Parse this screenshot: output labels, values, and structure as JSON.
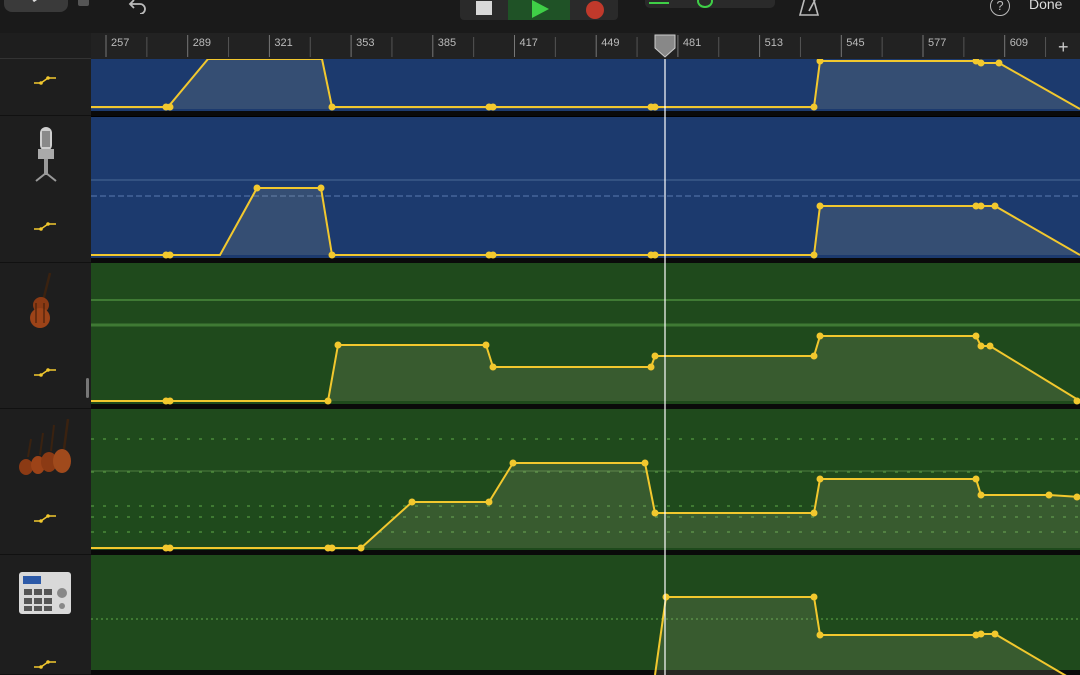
{
  "toolbar": {
    "done_label": "Done",
    "help_label": "?",
    "plus_label": "+"
  },
  "ruler": {
    "bars": [
      "257",
      "289",
      "321",
      "353",
      "385",
      "417",
      "449",
      "481",
      "513",
      "545",
      "577",
      "609"
    ]
  },
  "tracks": [
    {
      "name": "track-1",
      "icon": "automation-icon",
      "color": "#1c3a6e"
    },
    {
      "name": "track-2-vocal",
      "icon": "microphone-icon",
      "color": "#1c3a6e"
    },
    {
      "name": "track-3-cello",
      "icon": "cello-icon",
      "color": "#1f4a1c"
    },
    {
      "name": "track-4-strings",
      "icon": "string-section-icon",
      "color": "#1f4a1c"
    },
    {
      "name": "track-5-drum-machine",
      "icon": "drum-machine-icon",
      "color": "#1f4a1c"
    }
  ],
  "colors": {
    "automation_line": "#f2c82e",
    "audio_region": "#1c3a6e",
    "midi_region": "#1f4a1c",
    "playhead": "#ffffff"
  }
}
